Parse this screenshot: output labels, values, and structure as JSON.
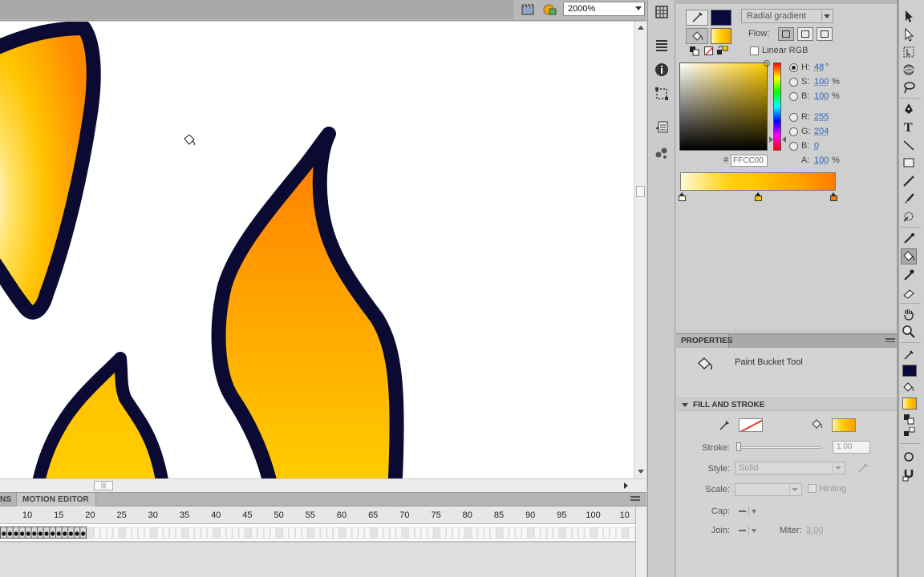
{
  "stage": {
    "zoom": "2000%"
  },
  "timeline": {
    "tabs": [
      {
        "label": "NS"
      },
      {
        "label": "MOTION EDITOR"
      }
    ],
    "frame_ticks": [
      "10",
      "15",
      "20",
      "25",
      "30",
      "35",
      "40",
      "45",
      "50",
      "55",
      "60",
      "65",
      "70",
      "75",
      "80",
      "85",
      "90",
      "95",
      "100",
      "10"
    ]
  },
  "color_panel": {
    "type": "Radial gradient",
    "flow_label": "Flow:",
    "linear_rgb_label": "Linear RGB",
    "h_label": "H:",
    "h_value": "48",
    "h_unit": "°",
    "s_label": "S:",
    "s_value": "100",
    "s_unit": "%",
    "b_label": "B:",
    "b_value": "100",
    "b_unit": "%",
    "r_label": "R:",
    "r_value": "255",
    "g_label": "G:",
    "g_value": "204",
    "bl_label": "B:",
    "bl_value": "0",
    "a_label": "A:",
    "a_value": "100",
    "a_unit": "%",
    "hex_hash": "#",
    "hex_value": "FFCC00",
    "stroke_color": "#0a0a3a",
    "fill_color": "#ffcc00"
  },
  "properties": {
    "tab_label": "PROPERTIES",
    "tool_name": "Paint Bucket Tool",
    "fill_stroke_title": "FILL AND STROKE",
    "stroke_label": "Stroke:",
    "stroke_value": "1.00",
    "style_label": "Style:",
    "style_value": "Solid",
    "scale_label": "Scale:",
    "hinting_label": "Hinting",
    "cap_label": "Cap:",
    "join_label": "Join:",
    "miter_label": "Miter:",
    "miter_value": "3.00"
  },
  "colors": {
    "flame_outline": "#0a0a33",
    "flame_orange": "#ff8a00",
    "flame_yellow": "#ffcc00"
  }
}
